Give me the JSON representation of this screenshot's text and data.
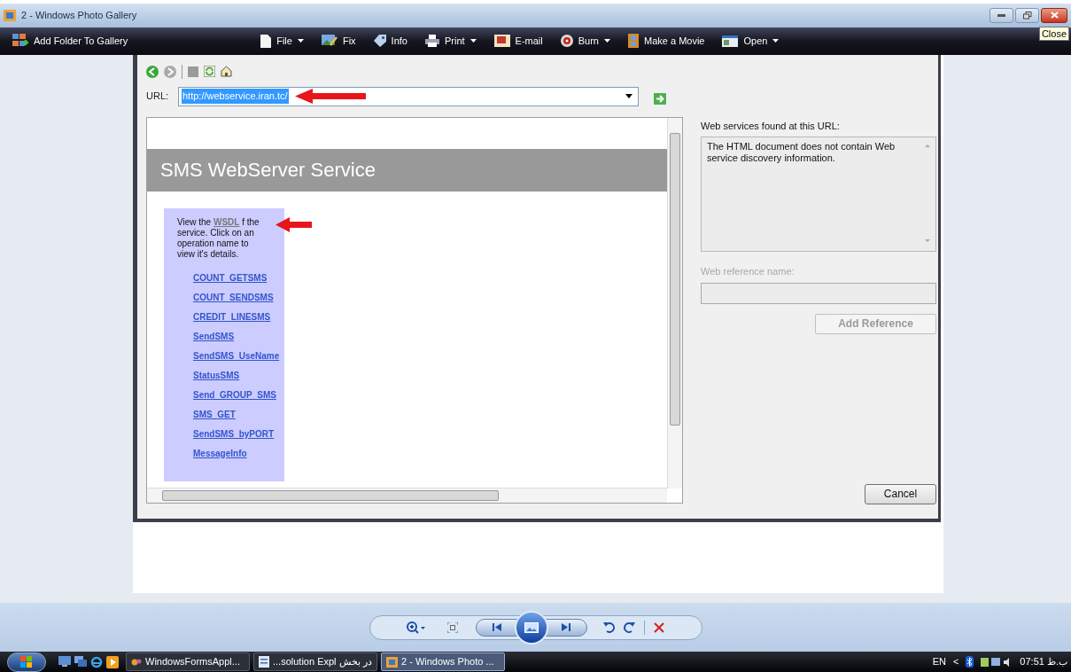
{
  "window": {
    "title": "2 - Windows Photo Gallery",
    "tooltip": "Close"
  },
  "toolbar": {
    "add_folder": "Add Folder To Gallery",
    "items": [
      {
        "kind": "file",
        "label": "File",
        "has_menu": true
      },
      {
        "kind": "fix",
        "label": "Fix",
        "has_menu": false
      },
      {
        "kind": "info",
        "label": "Info",
        "has_menu": false
      },
      {
        "kind": "print",
        "label": "Print",
        "has_menu": true
      },
      {
        "kind": "email",
        "label": "E-mail",
        "has_menu": false
      },
      {
        "kind": "burn",
        "label": "Burn",
        "has_menu": true
      },
      {
        "kind": "movie",
        "label": "Make a Movie",
        "has_menu": false
      },
      {
        "kind": "open",
        "label": "Open",
        "has_menu": true
      }
    ]
  },
  "dialog": {
    "url_label": "URL:",
    "url": {
      "value": "http://webservice.iran.tc/",
      "selected": true
    },
    "page": {
      "heading": "SMS WebServer Service",
      "intro": "View the **WSDL** f the service. Click on an operation name to view it's details.",
      "operations": [
        "COUNT_GETSMS",
        "COUNT_SENDSMS",
        "CREDIT_LINESMS",
        "SendSMS",
        "SendSMS_UseName",
        "StatusSMS",
        "Send_GROUP_SMS",
        "SMS_GET",
        "SendSMS_byPORT",
        "MessageInfo"
      ]
    },
    "found_label": "Web services found at this URL:",
    "found_message": "The HTML document does not contain Web service discovery information.",
    "reference_label": "Web reference name:",
    "reference_disabled": true,
    "add_button": {
      "label": "Add Reference",
      "disabled": true
    },
    "cancel_button": {
      "label": "Cancel",
      "disabled": false
    }
  },
  "taskbar": {
    "tasks": [
      {
        "kind": "app",
        "label": "WindowsFormsAppl...",
        "selected": false
      },
      {
        "kind": "doc",
        "label": "در بخش solution Expl...",
        "selected": false
      },
      {
        "kind": "gallery",
        "label": "2 - Windows Photo ...",
        "selected": true
      }
    ],
    "language": "EN",
    "tray_toggle": "<",
    "clock": "07:51 ب.ظ"
  }
}
